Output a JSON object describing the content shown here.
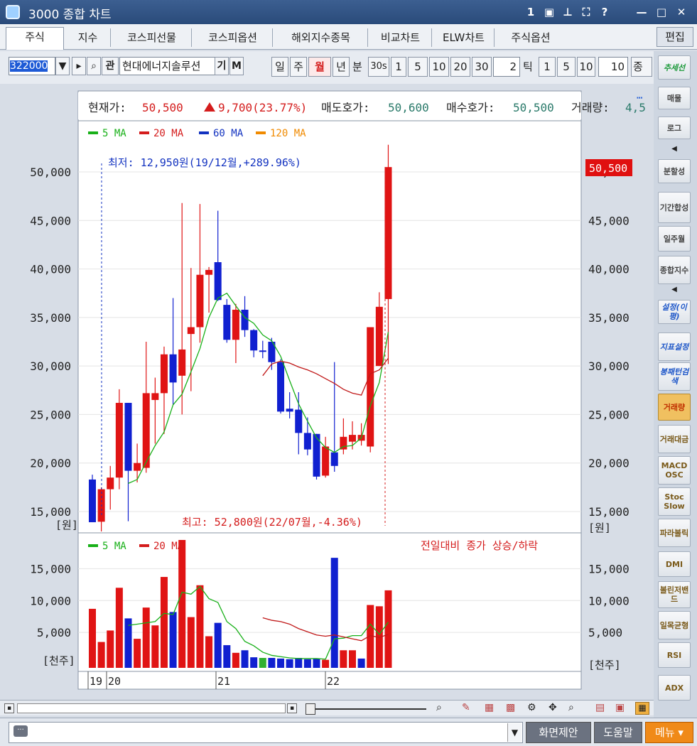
{
  "window": {
    "title": "3000 종합 차트",
    "buttons": [
      "1",
      "▣",
      "⊥",
      "⛶",
      "?",
      "—",
      "□",
      "✕"
    ]
  },
  "tabs": [
    "주식",
    "지수",
    "코스피선물",
    "코스피옵션",
    "해외지수종목",
    "비교차트",
    "ELW차트",
    "주식옵션"
  ],
  "edit_label": "편집",
  "toolbar": {
    "code": "322000",
    "search_icon": "search-icon",
    "gwan": "관",
    "stock_name": "현대에너지솔루션",
    "gi": "기",
    "m": "M",
    "periods": [
      "일",
      "주",
      "월",
      "년"
    ],
    "selected_period": "월",
    "min_label": "분",
    "sec_label": "30s",
    "min_values": [
      "1",
      "5",
      "10",
      "20",
      "30"
    ],
    "tick_count": "2",
    "tick_label": "틱",
    "tick_values": [
      "1",
      "5",
      "10"
    ],
    "right_count": "10",
    "right_label": "종목"
  },
  "info": {
    "price_label": "현재가:",
    "price": "50,500",
    "change": "9,700(23.77%)",
    "ask_label": "매도호가:",
    "ask": "50,600",
    "bid_label": "매수호가:",
    "bid": "50,500",
    "volume_label": "거래량:",
    "volume": "4,5"
  },
  "price_legend": [
    {
      "name": "5 MA",
      "color": "#18b018"
    },
    {
      "name": "20 MA",
      "color": "#d41c1c"
    },
    {
      "name": "60 MA",
      "color": "#1232c0"
    },
    {
      "name": "120 MA",
      "color": "#f08a00"
    }
  ],
  "volume_legend": [
    {
      "name": "5 MA",
      "color": "#18b018"
    },
    {
      "name": "20 MA",
      "color": "#d41c1c"
    }
  ],
  "volume_note": "전일대비 종가 상승/하락",
  "annotations": {
    "low": "최저: 12,950원(19/12월,+289.96%)",
    "high": "최고: 52,800원(22/07월,-4.36%)"
  },
  "price_tag": "50,500",
  "units": {
    "price": "[원]",
    "volume": "[천주]"
  },
  "sidebar": [
    "추세선",
    "매물",
    "로그",
    "◀",
    "분할성",
    "기간합성",
    "일주월",
    "종합지수",
    "◀",
    "설정(이평)",
    "지표설정",
    "봉패턴검색",
    "거래량",
    "거래대금",
    "MACD OSC",
    "Stoc Slow",
    "파라볼릭",
    "DMI",
    "볼린저밴드",
    "일목균형",
    "RSI",
    "ADX"
  ],
  "status": {
    "screen": "화면제안",
    "help": "도움말",
    "menu": "메뉴 ▾"
  },
  "chart_data": {
    "type": "candlestick",
    "title": "",
    "period": "monthly",
    "y_ticks": [
      15000,
      20000,
      25000,
      30000,
      35000,
      40000,
      45000,
      50000
    ],
    "y_range": [
      13000,
      52800
    ],
    "x_labels": [
      "19",
      "20",
      "21",
      "22"
    ],
    "candles": [
      {
        "o": 13900,
        "h": 18800,
        "l": 13900,
        "c": 18300,
        "up": false
      },
      {
        "o": 13950,
        "h": 17500,
        "l": 12950,
        "c": 17300,
        "up": true
      },
      {
        "o": 17300,
        "h": 19700,
        "l": 15200,
        "c": 18500,
        "up": true
      },
      {
        "o": 18500,
        "h": 27600,
        "l": 17300,
        "c": 26200,
        "up": true
      },
      {
        "o": 26200,
        "h": 26200,
        "l": 14000,
        "c": 19200,
        "up": false
      },
      {
        "o": 19200,
        "h": 22000,
        "l": 18000,
        "c": 20000,
        "up": true
      },
      {
        "o": 19500,
        "h": 32500,
        "l": 19000,
        "c": 27200,
        "up": true
      },
      {
        "o": 26500,
        "h": 28800,
        "l": 22000,
        "c": 27200,
        "up": true
      },
      {
        "o": 27200,
        "h": 32000,
        "l": 23000,
        "c": 31200,
        "up": true
      },
      {
        "o": 31200,
        "h": 37000,
        "l": 26000,
        "c": 28300,
        "up": false
      },
      {
        "o": 29000,
        "h": 46800,
        "l": 25000,
        "c": 31700,
        "up": true
      },
      {
        "o": 33300,
        "h": 40100,
        "l": 27400,
        "c": 34000,
        "up": true
      },
      {
        "o": 34000,
        "h": 46700,
        "l": 32400,
        "c": 39400,
        "up": true
      },
      {
        "o": 39400,
        "h": 40200,
        "l": 35500,
        "c": 39900,
        "up": true
      },
      {
        "o": 40700,
        "h": 46000,
        "l": 36700,
        "c": 36800,
        "up": false
      },
      {
        "o": 36300,
        "h": 36900,
        "l": 32400,
        "c": 32700,
        "up": false
      },
      {
        "o": 32700,
        "h": 36400,
        "l": 30300,
        "c": 35800,
        "up": true
      },
      {
        "o": 35800,
        "h": 37200,
        "l": 33000,
        "c": 33700,
        "up": false
      },
      {
        "o": 33700,
        "h": 33800,
        "l": 30900,
        "c": 31600,
        "up": false
      },
      {
        "o": 31600,
        "h": 32600,
        "l": 30800,
        "c": 31500,
        "up": false
      },
      {
        "o": 32500,
        "h": 32900,
        "l": 29600,
        "c": 30400,
        "up": false
      },
      {
        "o": 30400,
        "h": 30700,
        "l": 25100,
        "c": 25300,
        "up": false
      },
      {
        "o": 25300,
        "h": 27300,
        "l": 24600,
        "c": 25600,
        "up": false
      },
      {
        "o": 25500,
        "h": 27300,
        "l": 20900,
        "c": 23100,
        "up": false
      },
      {
        "o": 23100,
        "h": 24700,
        "l": 20800,
        "c": 21400,
        "up": false
      },
      {
        "o": 23000,
        "h": 23000,
        "l": 18300,
        "c": 18600,
        "up": false
      },
      {
        "o": 18700,
        "h": 22700,
        "l": 18500,
        "c": 21700,
        "up": true
      },
      {
        "o": 19700,
        "h": 30400,
        "l": 19100,
        "c": 21100,
        "up": false
      },
      {
        "o": 21400,
        "h": 24600,
        "l": 20900,
        "c": 22700,
        "up": true
      },
      {
        "o": 22200,
        "h": 24300,
        "l": 21400,
        "c": 22900,
        "up": true
      },
      {
        "o": 22900,
        "h": 24100,
        "l": 21800,
        "c": 22300,
        "up": true
      },
      {
        "o": 21700,
        "h": 26900,
        "l": 21100,
        "c": 34000,
        "up": true
      },
      {
        "o": 30000,
        "h": 37600,
        "l": 30000,
        "c": 36100,
        "up": true
      },
      {
        "o": 36900,
        "h": 52800,
        "l": 30200,
        "c": 50500,
        "up": true
      }
    ],
    "ma5": [
      null,
      null,
      null,
      null,
      17900,
      18300,
      20100,
      21800,
      23200,
      26000,
      27100,
      29400,
      31800,
      35000,
      37000,
      37500,
      36200,
      35000,
      34400,
      33200,
      32600,
      31000,
      28500,
      26100,
      24300,
      22600,
      21600,
      21100,
      21700,
      21800,
      22600,
      25900,
      28300,
      33500
    ],
    "ma20": [
      null,
      null,
      null,
      null,
      null,
      null,
      null,
      null,
      null,
      null,
      null,
      null,
      null,
      null,
      null,
      null,
      null,
      null,
      null,
      29000,
      30200,
      30500,
      30300,
      29900,
      29600,
      29200,
      28700,
      28200,
      27600,
      27200,
      27000,
      29200,
      29600,
      30800
    ],
    "volume_ticks": [
      5000,
      10000,
      15000
    ],
    "volume_range": [
      0,
      19500
    ],
    "volumes": [
      {
        "v": 8700,
        "c": "red"
      },
      {
        "v": 3500,
        "c": "red"
      },
      {
        "v": 5300,
        "c": "red"
      },
      {
        "v": 12000,
        "c": "red"
      },
      {
        "v": 7200,
        "c": "blue"
      },
      {
        "v": 4000,
        "c": "red"
      },
      {
        "v": 8900,
        "c": "red"
      },
      {
        "v": 6100,
        "c": "red"
      },
      {
        "v": 13700,
        "c": "red"
      },
      {
        "v": 8200,
        "c": "blue"
      },
      {
        "v": 19500,
        "c": "red"
      },
      {
        "v": 7400,
        "c": "red"
      },
      {
        "v": 12400,
        "c": "red"
      },
      {
        "v": 4400,
        "c": "red"
      },
      {
        "v": 6500,
        "c": "blue"
      },
      {
        "v": 3000,
        "c": "blue"
      },
      {
        "v": 1800,
        "c": "red"
      },
      {
        "v": 2200,
        "c": "blue"
      },
      {
        "v": 1100,
        "c": "blue"
      },
      {
        "v": 1000,
        "c": "green"
      },
      {
        "v": 1000,
        "c": "blue"
      },
      {
        "v": 900,
        "c": "blue"
      },
      {
        "v": 800,
        "c": "blue"
      },
      {
        "v": 1000,
        "c": "blue"
      },
      {
        "v": 800,
        "c": "blue"
      },
      {
        "v": 900,
        "c": "blue"
      },
      {
        "v": 700,
        "c": "red"
      },
      {
        "v": 16700,
        "c": "blue"
      },
      {
        "v": 2200,
        "c": "red"
      },
      {
        "v": 2200,
        "c": "red"
      },
      {
        "v": 900,
        "c": "blue"
      },
      {
        "v": 9300,
        "c": "red"
      },
      {
        "v": 9100,
        "c": "red"
      },
      {
        "v": 11600,
        "c": "red"
      }
    ],
    "vma5": [
      null,
      null,
      null,
      null,
      6100,
      6300,
      6500,
      6700,
      8000,
      7800,
      11300,
      11000,
      12200,
      10300,
      9700,
      6700,
      5600,
      3600,
      2900,
      1900,
      1400,
      1200,
      1000,
      900,
      900,
      900,
      800,
      4000,
      4100,
      4500,
      4500,
      6300,
      4700,
      6600
    ],
    "vma20": [
      null,
      null,
      null,
      null,
      null,
      null,
      null,
      null,
      null,
      null,
      null,
      null,
      null,
      null,
      null,
      null,
      null,
      null,
      null,
      7300,
      6900,
      6700,
      6300,
      5600,
      5100,
      4600,
      4400,
      4600,
      4300,
      4000,
      3700,
      4500,
      4200,
      4700
    ]
  }
}
